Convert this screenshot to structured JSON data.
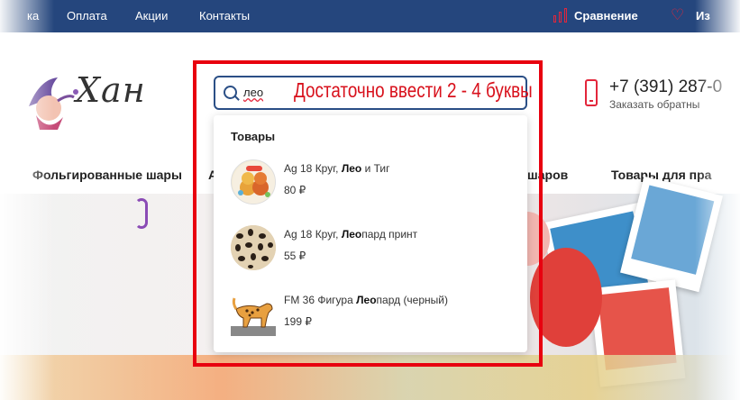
{
  "nav": {
    "links": [
      "ка",
      "Оплата",
      "Акции",
      "Контакты"
    ],
    "compare_label": "Сравнение",
    "favorites_label": "Из"
  },
  "logo": {
    "text": "Хан"
  },
  "search": {
    "value": "лео",
    "annotation": "Достаточно ввести  2 - 4 буквы"
  },
  "contact": {
    "phone": "+7 (391) 287-0",
    "callback": "Заказать обратны"
  },
  "categories": [
    "Фольгированные шары",
    "А",
    "я шаров",
    "Товары для пра"
  ],
  "dropdown": {
    "section_title": "Товары",
    "items": [
      {
        "name_prefix": "Ag 18 Круг, ",
        "name_bold": "Лео",
        "name_suffix": " и Тиг",
        "price": "80 ₽"
      },
      {
        "name_prefix": "Ag 18 Круг, ",
        "name_bold": "Лео",
        "name_suffix": "пард принт",
        "price": "55 ₽"
      },
      {
        "name_prefix": "FM 36 Фигура ",
        "name_bold": "Лео",
        "name_suffix": "пард (черный)",
        "price": "199 ₽"
      }
    ]
  },
  "colors": {
    "nav_bg": "#25467d",
    "accent": "#e3263b",
    "highlight_frame": "#e8000f",
    "annotation": "#d8111c"
  }
}
